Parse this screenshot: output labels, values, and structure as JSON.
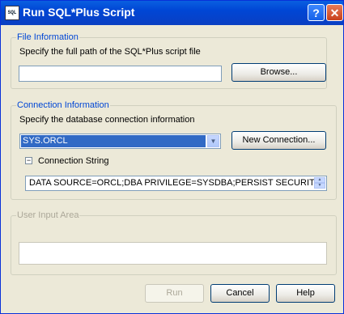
{
  "window": {
    "title": "Run SQL*Plus Script",
    "app_icon_text": "SQL",
    "help_glyph": "?",
    "close_glyph": "✕"
  },
  "file_info": {
    "legend": "File Information",
    "instruction": "Specify the full path of the SQL*Plus script file",
    "path_value": "",
    "browse_label": "Browse..."
  },
  "connection": {
    "legend": "Connection Information",
    "instruction": "Specify the database connection information",
    "selected": "SYS.ORCL",
    "new_connection_label": "New Connection...",
    "expander_glyph": "−",
    "string_label": "Connection String",
    "string_value": "DATA SOURCE=ORCL;DBA PRIVILEGE=SYSDBA;PERSIST SECURITY"
  },
  "user_input": {
    "legend": "User Input Area",
    "value": ""
  },
  "buttons": {
    "run": "Run",
    "cancel": "Cancel",
    "help": "Help"
  },
  "colors": {
    "title_bar": "#0046d5",
    "window_bg": "#ece9d8",
    "selection": "#316ac5",
    "legend": "#0046d5"
  }
}
